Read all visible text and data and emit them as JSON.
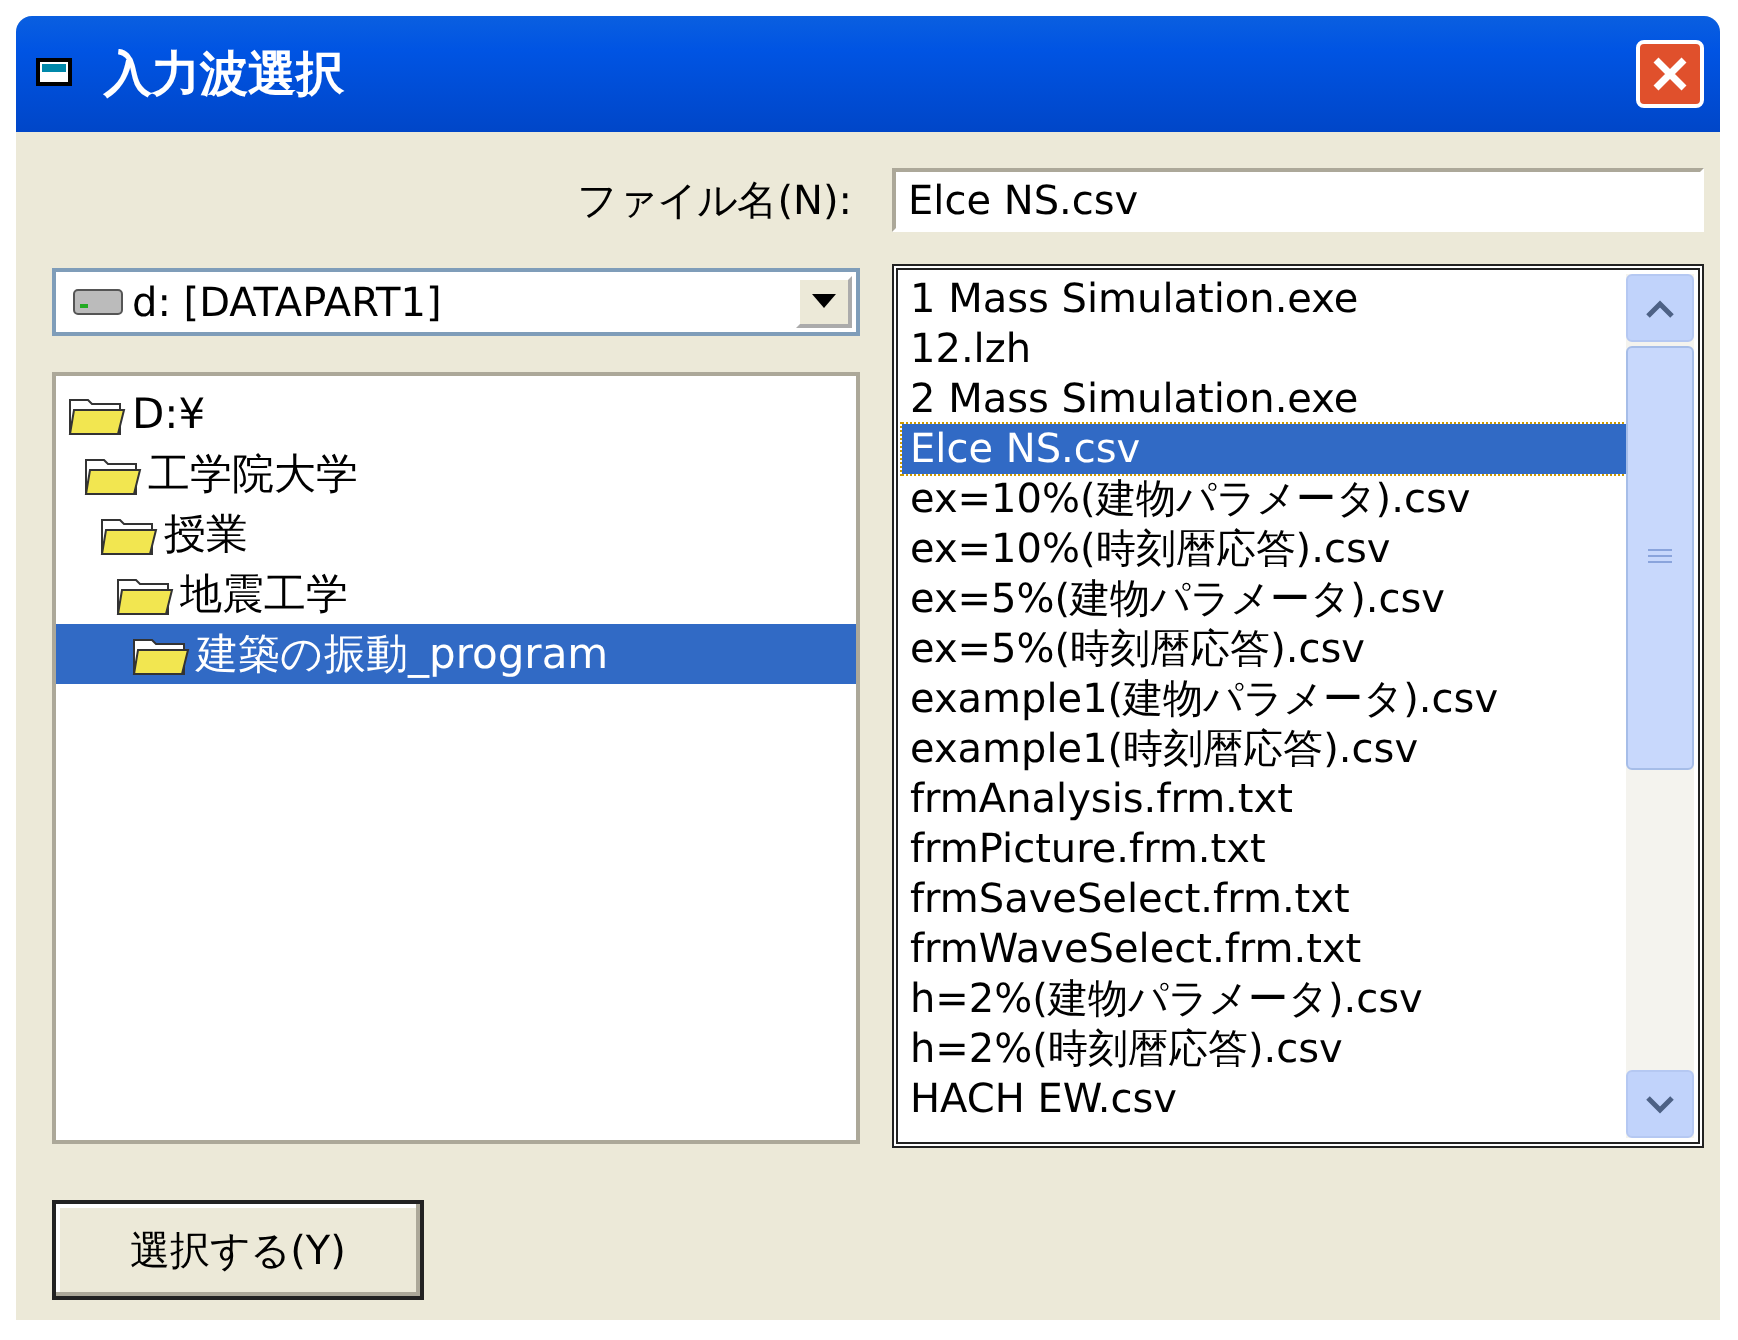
{
  "window": {
    "title": "入力波選択"
  },
  "filename": {
    "label": "ファイル名(N):",
    "value": "Elce NS.csv"
  },
  "drive": {
    "value": "d: [DATAPART1]"
  },
  "folders": [
    {
      "label": "D:¥",
      "selected": false,
      "children": [
        {
          "label": "工学院大学",
          "selected": false,
          "children": [
            {
              "label": "授業",
              "selected": false,
              "children": [
                {
                  "label": "地震工学",
                  "selected": false,
                  "children": [
                    {
                      "label": "建築の振動_program",
                      "selected": true
                    }
                  ]
                }
              ]
            }
          ]
        }
      ]
    }
  ],
  "files": [
    {
      "label": "1  Mass Simulation.exe",
      "selected": false
    },
    {
      "label": "12.lzh",
      "selected": false
    },
    {
      "label": "2  Mass Simulation.exe",
      "selected": false
    },
    {
      "label": "Elce NS.csv",
      "selected": true
    },
    {
      "label": "ex=10%(建物パラメータ).csv",
      "selected": false
    },
    {
      "label": "ex=10%(時刻暦応答).csv",
      "selected": false
    },
    {
      "label": "ex=5%(建物パラメータ).csv",
      "selected": false
    },
    {
      "label": "ex=5%(時刻暦応答).csv",
      "selected": false
    },
    {
      "label": "example1(建物パラメータ).csv",
      "selected": false
    },
    {
      "label": "example1(時刻暦応答).csv",
      "selected": false
    },
    {
      "label": "frmAnalysis.frm.txt",
      "selected": false
    },
    {
      "label": "frmPicture.frm.txt",
      "selected": false
    },
    {
      "label": "frmSaveSelect.frm.txt",
      "selected": false
    },
    {
      "label": "frmWaveSelect.frm.txt",
      "selected": false
    },
    {
      "label": "h=2%(建物パラメータ).csv",
      "selected": false
    },
    {
      "label": "h=2%(時刻暦応答).csv",
      "selected": false
    },
    {
      "label": "HACH EW.csv",
      "selected": false
    }
  ],
  "buttons": [
    {
      "label": "選択する(Y)"
    }
  ]
}
